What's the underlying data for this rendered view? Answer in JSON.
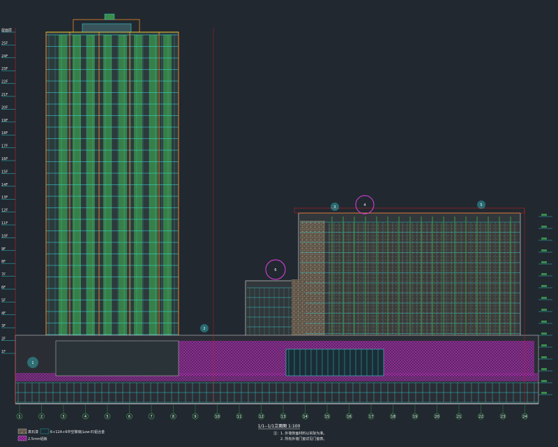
{
  "drawing": {
    "title": "1/1--1/1立面图 1:100",
    "background": "#212830"
  },
  "colors": {
    "green_fill": "#3a8c4a",
    "cyan_line": "#39e6ea",
    "orange_line": "#f08a2a",
    "magenta_line": "#e640e6",
    "red_line": "#e02020",
    "white_line": "#e8e8e8",
    "yellow": "#f2e23a",
    "stone": "#7a6e60"
  },
  "legend": {
    "items": [
      {
        "label": "真石漆"
      },
      {
        "label": "6+12A+6中空玻璃(Low-E)铝合金"
      },
      {
        "label": "2.5mm铝板"
      }
    ]
  },
  "notes": [
    "注：",
    "1. 外墙饰面材料以实际为准。",
    "2. 所有外墙门窗详见门窗表。"
  ],
  "level_labels_left": [
    "屋面层",
    "25F",
    "24F",
    "23F",
    "22F",
    "21F",
    "20F",
    "19F",
    "18F",
    "17F",
    "16F",
    "15F",
    "14F",
    "13F",
    "12F",
    "11F",
    "10F",
    "9F",
    "8F",
    "7F",
    "6F",
    "5F",
    "4F",
    "3F",
    "2F",
    "1F"
  ],
  "axis_tags_bottom": [
    "1",
    "2",
    "3",
    "4",
    "5",
    "6",
    "7",
    "8",
    "9",
    "10",
    "11",
    "12",
    "13",
    "14",
    "15",
    "16",
    "17",
    "18",
    "19",
    "20",
    "21",
    "22",
    "23",
    "24"
  ],
  "section_tags": [
    "1",
    "2",
    "3",
    "4",
    "5",
    "6"
  ]
}
